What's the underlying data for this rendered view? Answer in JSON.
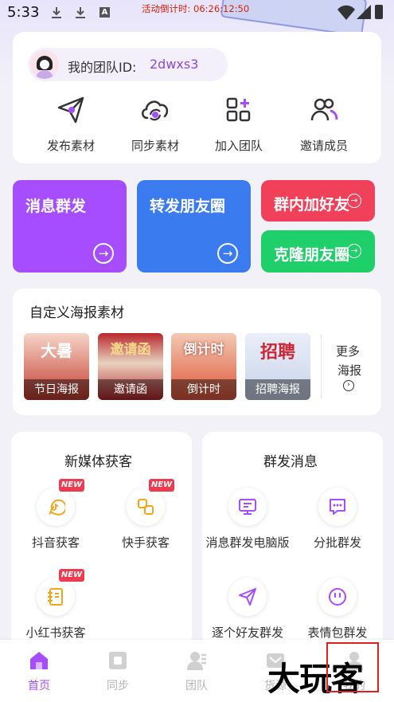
{
  "status_bar": {
    "time": "5:33",
    "a_icon": "A",
    "countdown": "活动倒计时: 06:26:12:50"
  },
  "team": {
    "id_label": "我的团队ID:",
    "id_value": "2dwxs3"
  },
  "actions": [
    {
      "label": "发布素材",
      "icon": "paper-plane-icon"
    },
    {
      "label": "同步素材",
      "icon": "cloud-sync-icon"
    },
    {
      "label": "加入团队",
      "icon": "grid-plus-icon"
    },
    {
      "label": "邀请成员",
      "icon": "users-icon"
    }
  ],
  "tiles": {
    "mass_message": "消息群发",
    "repost_moments": "转发朋友圈",
    "group_add_friend": "群内加好友",
    "clone_moments": "克隆朋友圈"
  },
  "posters": {
    "title": "自定义海报素材",
    "items": [
      {
        "label": "节日海报",
        "art_text": "大暑"
      },
      {
        "label": "邀请函",
        "art_text": "邀请函"
      },
      {
        "label": "倒计时",
        "art_text": "倒计时"
      },
      {
        "label": "招聘海报",
        "art_text": "招聘"
      }
    ],
    "more_line1": "更多",
    "more_line2": "海报"
  },
  "new_media": {
    "title": "新媒体获客",
    "items": [
      {
        "label": "抖音获客",
        "badge": "NEW"
      },
      {
        "label": "快手获客",
        "badge": "NEW"
      },
      {
        "label": "小红书获客",
        "badge": "NEW"
      }
    ]
  },
  "group_send": {
    "title": "群发消息",
    "items": [
      {
        "label": "消息群发电脑版"
      },
      {
        "label": "分批群发"
      },
      {
        "label": "逐个好友群发"
      },
      {
        "label": "表情包群发"
      }
    ]
  },
  "tabs": [
    {
      "label": "首页",
      "active": true
    },
    {
      "label": "同步",
      "active": false
    },
    {
      "label": "团队",
      "active": false
    },
    {
      "label": "货源",
      "active": false
    },
    {
      "label": "我的",
      "active": false
    }
  ],
  "watermark": "大玩客",
  "colors": {
    "purple": "#a64dff",
    "blue": "#3a7bf0",
    "red": "#f0405a",
    "green": "#1fcf6a",
    "accent": "#8b4ae8"
  }
}
